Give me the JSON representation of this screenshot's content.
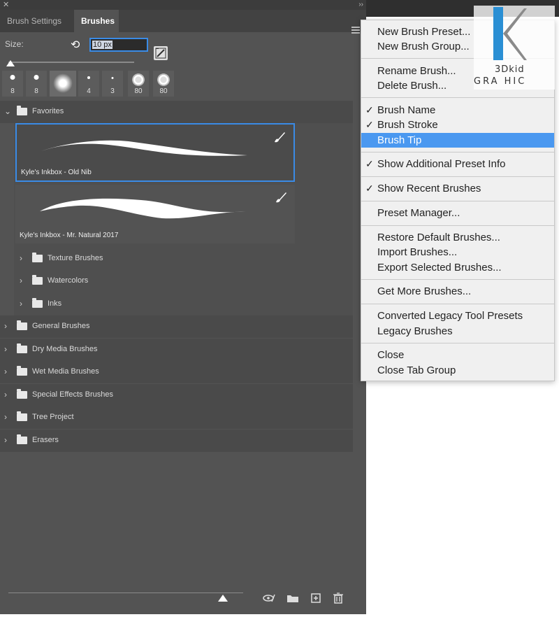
{
  "tabs": {
    "brush_settings": "Brush Settings",
    "brushes": "Brushes"
  },
  "size": {
    "label": "Size:",
    "value": "10 px"
  },
  "recent_brushes": [
    {
      "size": "8",
      "kind": "hard-round"
    },
    {
      "size": "8",
      "kind": "hard-round"
    },
    {
      "size": "",
      "kind": "soft-round"
    },
    {
      "size": "4",
      "kind": "hard-round"
    },
    {
      "size": "3",
      "kind": "hard-round"
    },
    {
      "size": "80",
      "kind": "flower"
    },
    {
      "size": "80",
      "kind": "flower"
    }
  ],
  "tree": {
    "favorites": "Favorites",
    "brush1": "Kyle's Inkbox - Old Nib",
    "brush2": "Kyle's Inkbox - Mr. Natural 2017",
    "sub_groups": [
      "Texture Brushes",
      "Watercolors",
      "Inks"
    ],
    "groups": [
      "General Brushes",
      "Dry Media Brushes",
      "Wet Media Brushes",
      "Special Effects Brushes",
      "Tree Project",
      "Erasers"
    ]
  },
  "menu": {
    "new_preset": "New Brush Preset...",
    "new_group": "New Brush Group...",
    "rename": "Rename Brush...",
    "delete": "Delete Brush...",
    "brush_name": "Brush Name",
    "brush_stroke": "Brush Stroke",
    "brush_tip": "Brush Tip",
    "show_info": "Show Additional Preset Info",
    "show_recent": "Show Recent Brushes",
    "preset_manager": "Preset Manager...",
    "restore": "Restore Default Brushes...",
    "import": "Import Brushes...",
    "export": "Export Selected Brushes...",
    "get_more": "Get More Brushes...",
    "converted": "Converted Legacy Tool Presets",
    "legacy": "Legacy Brushes",
    "close": "Close",
    "close_group": "Close Tab Group"
  },
  "watermark": {
    "line1": "3Dkid",
    "line2": "GRA  HIC"
  },
  "colors": {
    "panel": "#535353",
    "accent": "#3a8be6",
    "menu_bg": "#f0f0f0",
    "menu_highlight": "#4a98f0"
  }
}
